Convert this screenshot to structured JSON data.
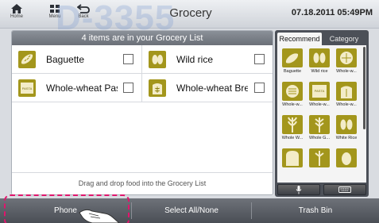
{
  "topbar": {
    "home_label": "Home",
    "menu_label": "Menu",
    "back_label": "Back",
    "title": "Grocery",
    "datetime": "07.18.2011 05:49PM"
  },
  "main": {
    "header": "4 items are in your Grocery List",
    "items": [
      {
        "name": "Baguette",
        "icon": "baguette-icon"
      },
      {
        "name": "Wild rice",
        "icon": "wild-rice-icon"
      },
      {
        "name": "Whole-wheat Pas",
        "icon": "pasta-icon",
        "badge": "PASTA"
      },
      {
        "name": "Whole-wheat Bre",
        "icon": "bread-icon"
      }
    ],
    "drag_hint": "Drag and drop food into the Grocery List"
  },
  "side": {
    "tabs": [
      {
        "label": "Recommend",
        "active": true
      },
      {
        "label": "Category",
        "active": false
      }
    ],
    "tiles": [
      {
        "label": "Baguette",
        "icon": "baguette-icon"
      },
      {
        "label": "Wild rice",
        "icon": "wild-rice-icon"
      },
      {
        "label": "Whole-w...",
        "icon": "tortilla-icon"
      },
      {
        "label": "Whole-w...",
        "icon": "cracker-icon"
      },
      {
        "label": "Whole-w...",
        "icon": "pasta-icon",
        "badge": "PASTA"
      },
      {
        "label": "Whole-w...",
        "icon": "bread-icon"
      },
      {
        "label": "Whole W...",
        "icon": "wheat-icon"
      },
      {
        "label": "Whole G...",
        "icon": "grain-icon"
      },
      {
        "label": "White Rice",
        "icon": "rice-icon"
      },
      {
        "label": "",
        "icon": "toast-icon"
      },
      {
        "label": "",
        "icon": "barley-icon"
      },
      {
        "label": "",
        "icon": "seed-icon"
      }
    ]
  },
  "bottom": {
    "phone": "Phone",
    "select_all": "Select All/None",
    "trash": "Trash Bin"
  },
  "watermark": "D-3355",
  "colors": {
    "food_tile": "#a3961c",
    "header_gray": "#7b8088",
    "highlight": "#e0156c"
  }
}
